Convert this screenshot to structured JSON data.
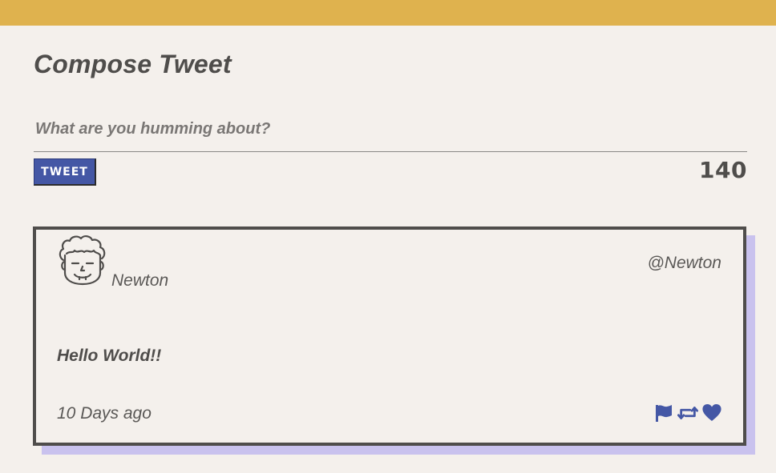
{
  "colors": {
    "topbar": "#dfb24e",
    "background": "#f4f0ec",
    "text": "#4f4d4b",
    "accent": "#4457a5",
    "card_shadow": "#c9c2ee"
  },
  "compose": {
    "title": "Compose Tweet",
    "input_placeholder": "What are you humming about?",
    "input_value": "",
    "tweet_button_label": "TWEET",
    "char_count": "140"
  },
  "tweet": {
    "avatar_icon": "cartoon-face-avatar",
    "display_name": "Newton",
    "handle": "@Newton",
    "text": "Hello World!!",
    "timestamp": "10 Days ago",
    "actions": [
      {
        "icon": "flag-icon"
      },
      {
        "icon": "retweet-icon"
      },
      {
        "icon": "heart-icon"
      }
    ]
  }
}
